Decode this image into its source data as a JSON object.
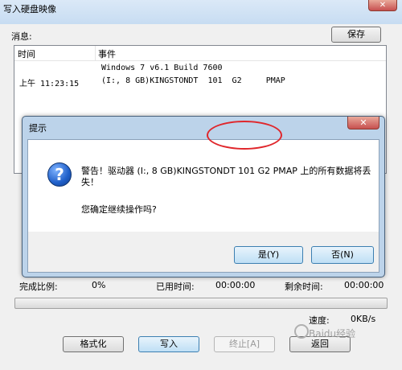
{
  "window": {
    "title": "写入硬盘映像",
    "close_glyph": "✕"
  },
  "log": {
    "section_label": "消息:",
    "save_button": "保存",
    "headers": {
      "time": "时间",
      "event": "事件"
    },
    "entries": [
      {
        "time": "",
        "event": "Windows 7 v6.1 Build 7600"
      },
      {
        "time": "上午 11:23:15",
        "event": "(I:, 8 GB)KINGSTONDT  101  G2     PMAP"
      }
    ]
  },
  "status": {
    "complete_label": "完成比例:",
    "complete_value": "0%",
    "elapsed_label": "已用时间:",
    "elapsed_value": "00:00:00",
    "remaining_label": "剩余时间:",
    "remaining_value": "00:00:00",
    "speed_label": "速度:",
    "speed_value": "0KB/s",
    "progress_fraction": 0
  },
  "buttons": {
    "format": "格式化",
    "write": "写入",
    "stop": "终止[A]",
    "back": "返回"
  },
  "dialog": {
    "title": "提示",
    "close_glyph": "✕",
    "icon": "question-icon",
    "icon_glyph": "?",
    "warning": "警告！驱动器 (I:, 8 GB)KINGSTONDT  101  G2    PMAP 上的所有数据将丢失！",
    "confirm": "您确定继续操作吗?",
    "yes": "是(Y)",
    "no": "否(N)"
  },
  "watermark": "Baidu经验"
}
